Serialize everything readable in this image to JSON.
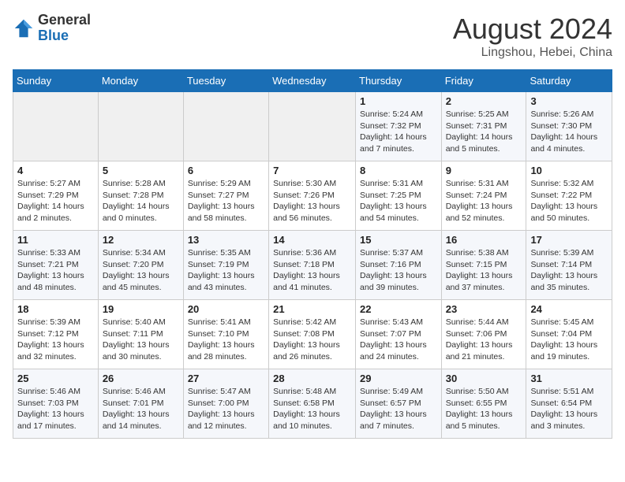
{
  "header": {
    "logo_line1": "General",
    "logo_line2": "Blue",
    "month_title": "August 2024",
    "location": "Lingshou, Hebei, China"
  },
  "weekdays": [
    "Sunday",
    "Monday",
    "Tuesday",
    "Wednesday",
    "Thursday",
    "Friday",
    "Saturday"
  ],
  "weeks": [
    [
      {
        "day": "",
        "sunrise": "",
        "sunset": "",
        "daylight": ""
      },
      {
        "day": "",
        "sunrise": "",
        "sunset": "",
        "daylight": ""
      },
      {
        "day": "",
        "sunrise": "",
        "sunset": "",
        "daylight": ""
      },
      {
        "day": "",
        "sunrise": "",
        "sunset": "",
        "daylight": ""
      },
      {
        "day": "1",
        "sunrise": "Sunrise: 5:24 AM",
        "sunset": "Sunset: 7:32 PM",
        "daylight": "Daylight: 14 hours and 7 minutes."
      },
      {
        "day": "2",
        "sunrise": "Sunrise: 5:25 AM",
        "sunset": "Sunset: 7:31 PM",
        "daylight": "Daylight: 14 hours and 5 minutes."
      },
      {
        "day": "3",
        "sunrise": "Sunrise: 5:26 AM",
        "sunset": "Sunset: 7:30 PM",
        "daylight": "Daylight: 14 hours and 4 minutes."
      }
    ],
    [
      {
        "day": "4",
        "sunrise": "Sunrise: 5:27 AM",
        "sunset": "Sunset: 7:29 PM",
        "daylight": "Daylight: 14 hours and 2 minutes."
      },
      {
        "day": "5",
        "sunrise": "Sunrise: 5:28 AM",
        "sunset": "Sunset: 7:28 PM",
        "daylight": "Daylight: 14 hours and 0 minutes."
      },
      {
        "day": "6",
        "sunrise": "Sunrise: 5:29 AM",
        "sunset": "Sunset: 7:27 PM",
        "daylight": "Daylight: 13 hours and 58 minutes."
      },
      {
        "day": "7",
        "sunrise": "Sunrise: 5:30 AM",
        "sunset": "Sunset: 7:26 PM",
        "daylight": "Daylight: 13 hours and 56 minutes."
      },
      {
        "day": "8",
        "sunrise": "Sunrise: 5:31 AM",
        "sunset": "Sunset: 7:25 PM",
        "daylight": "Daylight: 13 hours and 54 minutes."
      },
      {
        "day": "9",
        "sunrise": "Sunrise: 5:31 AM",
        "sunset": "Sunset: 7:24 PM",
        "daylight": "Daylight: 13 hours and 52 minutes."
      },
      {
        "day": "10",
        "sunrise": "Sunrise: 5:32 AM",
        "sunset": "Sunset: 7:22 PM",
        "daylight": "Daylight: 13 hours and 50 minutes."
      }
    ],
    [
      {
        "day": "11",
        "sunrise": "Sunrise: 5:33 AM",
        "sunset": "Sunset: 7:21 PM",
        "daylight": "Daylight: 13 hours and 48 minutes."
      },
      {
        "day": "12",
        "sunrise": "Sunrise: 5:34 AM",
        "sunset": "Sunset: 7:20 PM",
        "daylight": "Daylight: 13 hours and 45 minutes."
      },
      {
        "day": "13",
        "sunrise": "Sunrise: 5:35 AM",
        "sunset": "Sunset: 7:19 PM",
        "daylight": "Daylight: 13 hours and 43 minutes."
      },
      {
        "day": "14",
        "sunrise": "Sunrise: 5:36 AM",
        "sunset": "Sunset: 7:18 PM",
        "daylight": "Daylight: 13 hours and 41 minutes."
      },
      {
        "day": "15",
        "sunrise": "Sunrise: 5:37 AM",
        "sunset": "Sunset: 7:16 PM",
        "daylight": "Daylight: 13 hours and 39 minutes."
      },
      {
        "day": "16",
        "sunrise": "Sunrise: 5:38 AM",
        "sunset": "Sunset: 7:15 PM",
        "daylight": "Daylight: 13 hours and 37 minutes."
      },
      {
        "day": "17",
        "sunrise": "Sunrise: 5:39 AM",
        "sunset": "Sunset: 7:14 PM",
        "daylight": "Daylight: 13 hours and 35 minutes."
      }
    ],
    [
      {
        "day": "18",
        "sunrise": "Sunrise: 5:39 AM",
        "sunset": "Sunset: 7:12 PM",
        "daylight": "Daylight: 13 hours and 32 minutes."
      },
      {
        "day": "19",
        "sunrise": "Sunrise: 5:40 AM",
        "sunset": "Sunset: 7:11 PM",
        "daylight": "Daylight: 13 hours and 30 minutes."
      },
      {
        "day": "20",
        "sunrise": "Sunrise: 5:41 AM",
        "sunset": "Sunset: 7:10 PM",
        "daylight": "Daylight: 13 hours and 28 minutes."
      },
      {
        "day": "21",
        "sunrise": "Sunrise: 5:42 AM",
        "sunset": "Sunset: 7:08 PM",
        "daylight": "Daylight: 13 hours and 26 minutes."
      },
      {
        "day": "22",
        "sunrise": "Sunrise: 5:43 AM",
        "sunset": "Sunset: 7:07 PM",
        "daylight": "Daylight: 13 hours and 24 minutes."
      },
      {
        "day": "23",
        "sunrise": "Sunrise: 5:44 AM",
        "sunset": "Sunset: 7:06 PM",
        "daylight": "Daylight: 13 hours and 21 minutes."
      },
      {
        "day": "24",
        "sunrise": "Sunrise: 5:45 AM",
        "sunset": "Sunset: 7:04 PM",
        "daylight": "Daylight: 13 hours and 19 minutes."
      }
    ],
    [
      {
        "day": "25",
        "sunrise": "Sunrise: 5:46 AM",
        "sunset": "Sunset: 7:03 PM",
        "daylight": "Daylight: 13 hours and 17 minutes."
      },
      {
        "day": "26",
        "sunrise": "Sunrise: 5:46 AM",
        "sunset": "Sunset: 7:01 PM",
        "daylight": "Daylight: 13 hours and 14 minutes."
      },
      {
        "day": "27",
        "sunrise": "Sunrise: 5:47 AM",
        "sunset": "Sunset: 7:00 PM",
        "daylight": "Daylight: 13 hours and 12 minutes."
      },
      {
        "day": "28",
        "sunrise": "Sunrise: 5:48 AM",
        "sunset": "Sunset: 6:58 PM",
        "daylight": "Daylight: 13 hours and 10 minutes."
      },
      {
        "day": "29",
        "sunrise": "Sunrise: 5:49 AM",
        "sunset": "Sunset: 6:57 PM",
        "daylight": "Daylight: 13 hours and 7 minutes."
      },
      {
        "day": "30",
        "sunrise": "Sunrise: 5:50 AM",
        "sunset": "Sunset: 6:55 PM",
        "daylight": "Daylight: 13 hours and 5 minutes."
      },
      {
        "day": "31",
        "sunrise": "Sunrise: 5:51 AM",
        "sunset": "Sunset: 6:54 PM",
        "daylight": "Daylight: 13 hours and 3 minutes."
      }
    ]
  ]
}
